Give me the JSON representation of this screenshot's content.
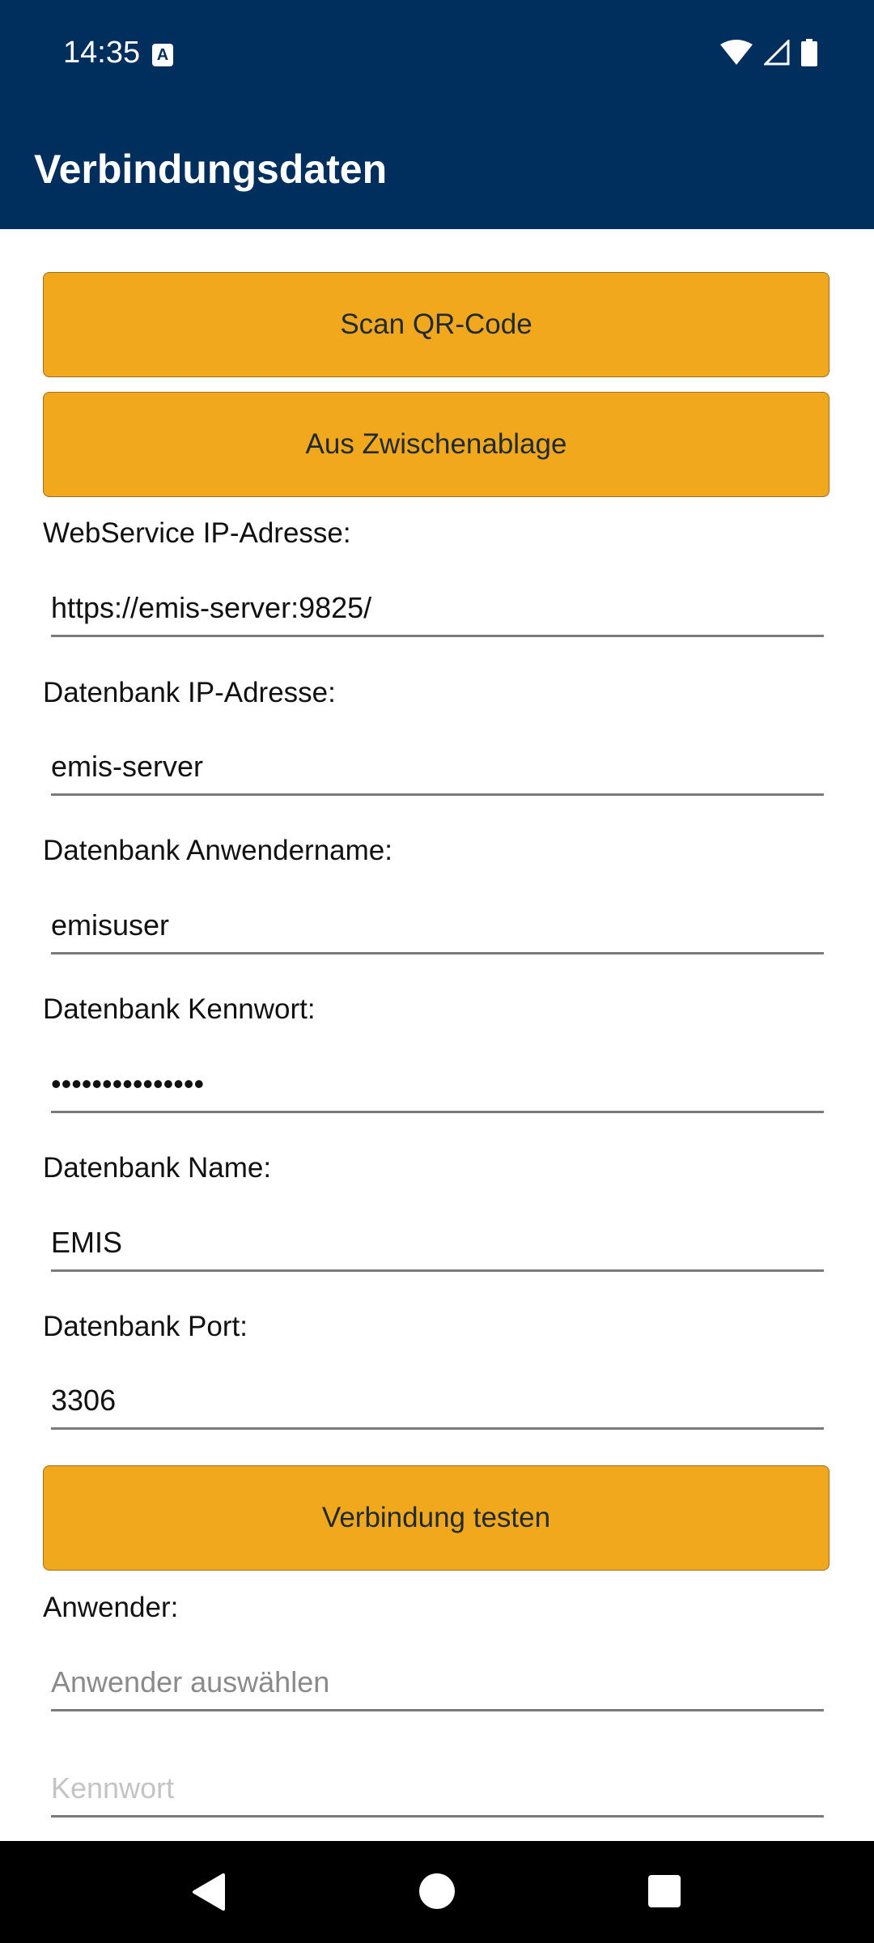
{
  "status": {
    "time": "14:35",
    "a_icon_label": "A"
  },
  "appbar": {
    "title": "Verbindungsdaten"
  },
  "buttons": {
    "scan": "Scan QR-Code",
    "clipboard": "Aus Zwischenablage",
    "test": "Verbindung testen"
  },
  "fields": {
    "webservice": {
      "label": "WebService IP-Adresse:",
      "value": "https://emis-server:9825/"
    },
    "db_ip": {
      "label": "Datenbank IP-Adresse:",
      "value": "emis-server"
    },
    "db_user": {
      "label": "Datenbank Anwendername:",
      "value": "emisuser"
    },
    "db_password": {
      "label": "Datenbank Kennwort:",
      "value": "•••••••••••••••"
    },
    "db_name": {
      "label": "Datenbank Name:",
      "value": "EMIS"
    },
    "db_port": {
      "label": "Datenbank Port:",
      "value": "3306"
    }
  },
  "user": {
    "label": "Anwender:",
    "placeholder": "Anwender auswählen",
    "password_placeholder": "Kennwort"
  },
  "colors": {
    "primary": "#002e5d",
    "accent": "#f2a81c"
  }
}
